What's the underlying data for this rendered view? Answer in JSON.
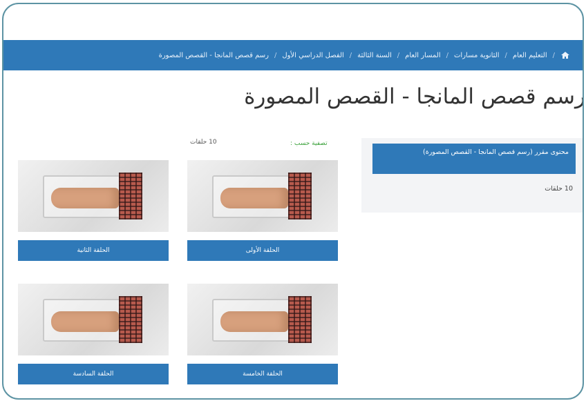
{
  "breadcrumb": {
    "items": [
      "التعليم العام",
      "الثانوية مسارات",
      "المسار العام",
      "السنة الثالثة",
      "الفصل الدراسي الأول",
      "رسم قصص المانجا - القصص المصورة"
    ],
    "separator": "/",
    "home_icon": "home-icon"
  },
  "page": {
    "title": "رسم قصص المانجا - القصص المصورة"
  },
  "sidebar": {
    "box_text": "محتوى مقرر (رسم قصص المانجا - القصص المصورة)",
    "count_text": "10 حلقات"
  },
  "filters": {
    "label": "تصفية حسب :",
    "count": "10 حلقات"
  },
  "cards": [
    {
      "label": "الحلقة الأولى"
    },
    {
      "label": "الحلقة الثانية"
    },
    {
      "label": "الحلقة الخامسة"
    },
    {
      "label": "الحلقة السادسة"
    }
  ],
  "colors": {
    "accent": "#2f79b8",
    "frame": "#5c93a3",
    "green": "#3aa13a"
  }
}
